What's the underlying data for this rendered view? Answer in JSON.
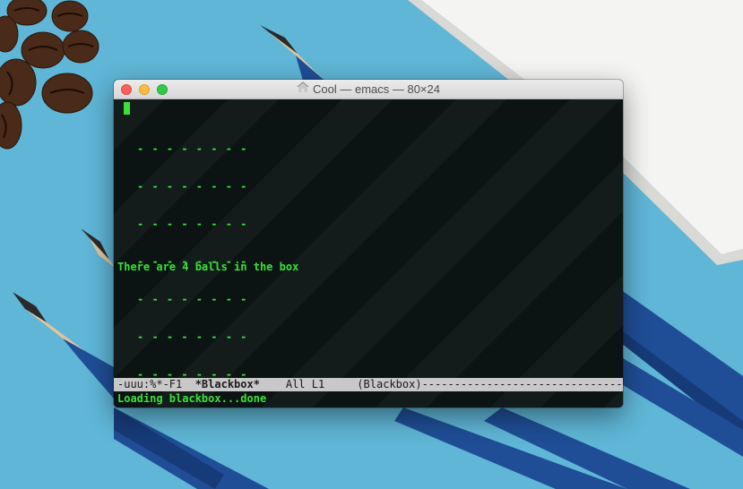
{
  "window": {
    "title": "Cool — emacs — 80×24"
  },
  "terminal": {
    "grid_rows": [
      "- - - - - - - -",
      "- - - - - - - -",
      "- - - - - - - -",
      "- - - - - - - -",
      "- - - - - - - -",
      "- - - - - - - -",
      "- - - - - - - -",
      "- - - - - - - -"
    ],
    "status_message": "There are 4 balls in the box"
  },
  "modeline": {
    "prefix": "-uuu:%*-F1  ",
    "buffer_name": "*Blackbox*",
    "position": "    All L1     ",
    "mode": "(Blackbox)----------------------------------------"
  },
  "echo_area": {
    "message": "Loading blackbox...done"
  },
  "colors": {
    "terminal_bg": "#0b1413",
    "terminal_fg": "#3be03b",
    "desktop_bg": "#5fb6d6",
    "close": "#fc605c",
    "minimize": "#fdbc40",
    "maximize": "#34c84a"
  },
  "icons": {
    "title_icon": "home-icon",
    "cursor": "block-cursor"
  }
}
